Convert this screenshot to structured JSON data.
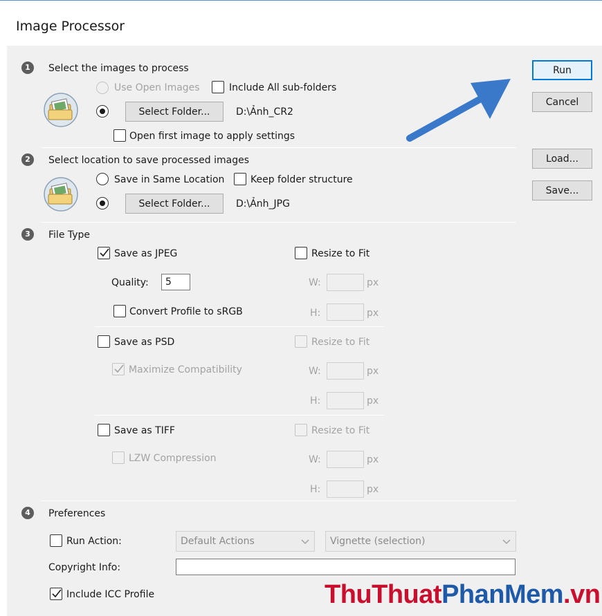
{
  "window": {
    "title": "Image Processor"
  },
  "buttons": {
    "run": "Run",
    "cancel": "Cancel",
    "load": "Load...",
    "save": "Save..."
  },
  "section1": {
    "number": "1",
    "heading": "Select the images to process",
    "use_open_images": "Use Open Images",
    "include_subfolders": "Include All sub-folders",
    "select_folder": "Select Folder...",
    "folder_path": "D:\\Ảnh_CR2",
    "open_first_image": "Open first image to apply settings"
  },
  "section2": {
    "number": "2",
    "heading": "Select location to save processed images",
    "save_same_location": "Save in Same Location",
    "keep_folder_structure": "Keep folder structure",
    "select_folder": "Select Folder...",
    "folder_path": "D:\\Ảnh_JPG"
  },
  "section3": {
    "number": "3",
    "heading": "File Type",
    "jpeg": {
      "label": "Save as JPEG",
      "checked": true,
      "quality_label": "Quality:",
      "quality_value": "5",
      "convert_profile": "Convert Profile to sRGB",
      "resize": "Resize to Fit",
      "w_label": "W:",
      "h_label": "H:",
      "unit": "px"
    },
    "psd": {
      "label": "Save as PSD",
      "checked": false,
      "maximize": "Maximize Compatibility",
      "resize": "Resize to Fit",
      "w_label": "W:",
      "h_label": "H:",
      "unit": "px"
    },
    "tiff": {
      "label": "Save as TIFF",
      "checked": false,
      "lzw": "LZW Compression",
      "resize": "Resize to Fit",
      "w_label": "W:",
      "h_label": "H:",
      "unit": "px"
    }
  },
  "section4": {
    "number": "4",
    "heading": "Preferences",
    "run_action": "Run Action:",
    "action_set": "Default Actions",
    "action": "Vignette (selection)",
    "copyright_label": "Copyright Info:",
    "copyright_value": "",
    "include_icc": "Include ICC Profile"
  },
  "watermark": {
    "part1": "ThuThuat",
    "part2": "PhanMem",
    "part3": ".vn"
  },
  "colors": {
    "accent": "#0078d7",
    "arrow": "#3a78c9",
    "watermark_red": "#c8102e",
    "watermark_blue": "#1e5aa8"
  }
}
